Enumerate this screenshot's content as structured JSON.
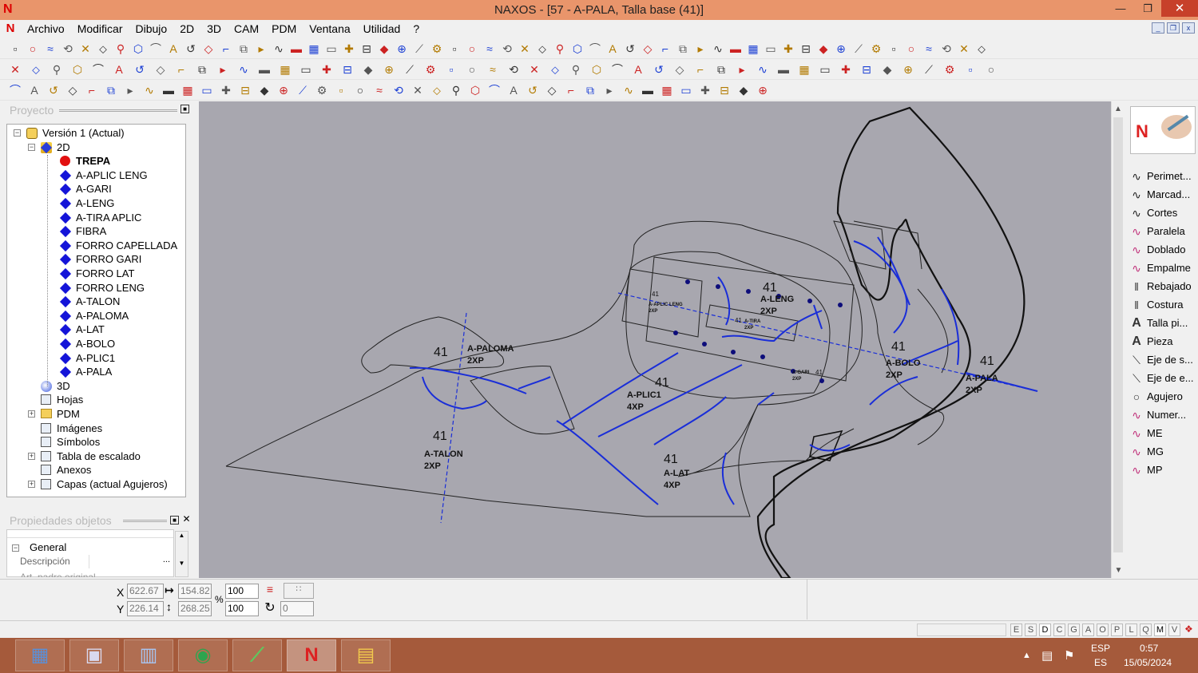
{
  "window": {
    "title": "NAXOS - [57 - A-PALA, Talla base (41)]"
  },
  "menu": [
    "Archivo",
    "Modificar",
    "Dibujo",
    "2D",
    "3D",
    "CAM",
    "PDM",
    "Ventana",
    "Utilidad",
    "?"
  ],
  "project_panel": {
    "title": "Proyecto",
    "tree": [
      {
        "label": "Versión 1 (Actual)",
        "level": 0,
        "expander": "−",
        "icon": "version-icon"
      },
      {
        "label": "2D",
        "level": 1,
        "expander": "−",
        "icon": "2d-icon"
      },
      {
        "label": "TREPA",
        "level": 2,
        "icon": "red-dot-icon",
        "bold": true
      },
      {
        "label": "A-APLIC LENG",
        "level": 2,
        "icon": "piece-diamond-icon"
      },
      {
        "label": "A-GARI",
        "level": 2,
        "icon": "piece-diamond-icon"
      },
      {
        "label": "A-LENG",
        "level": 2,
        "icon": "piece-diamond-icon"
      },
      {
        "label": "A-TIRA APLIC",
        "level": 2,
        "icon": "piece-diamond-icon"
      },
      {
        "label": "FIBRA",
        "level": 2,
        "icon": "piece-diamond-icon"
      },
      {
        "label": "FORRO CAPELLADA",
        "level": 2,
        "icon": "piece-diamond-icon"
      },
      {
        "label": "FORRO GARI",
        "level": 2,
        "icon": "piece-diamond-icon"
      },
      {
        "label": "FORRO LAT",
        "level": 2,
        "icon": "piece-diamond-icon"
      },
      {
        "label": "FORRO LENG",
        "level": 2,
        "icon": "piece-diamond-icon"
      },
      {
        "label": "A-TALON",
        "level": 2,
        "icon": "piece-diamond-icon"
      },
      {
        "label": "A-PALOMA",
        "level": 2,
        "icon": "piece-diamond-icon"
      },
      {
        "label": "A-LAT",
        "level": 2,
        "icon": "piece-diamond-icon"
      },
      {
        "label": "A-BOLO",
        "level": 2,
        "icon": "piece-diamond-icon"
      },
      {
        "label": "A-PLIC1",
        "level": 2,
        "icon": "piece-diamond-icon"
      },
      {
        "label": "A-PALA",
        "level": 2,
        "icon": "piece-diamond-icon"
      },
      {
        "label": "3D",
        "level": 1,
        "icon": "3d-icon"
      },
      {
        "label": "Hojas",
        "level": 1,
        "icon": "sheets-icon"
      },
      {
        "label": "PDM",
        "level": 1,
        "expander": "+",
        "icon": "folder-icon"
      },
      {
        "label": "Imágenes",
        "level": 1,
        "icon": "images-icon"
      },
      {
        "label": "Símbolos",
        "level": 1,
        "icon": "symbols-icon"
      },
      {
        "label": "Tabla de escalado",
        "level": 1,
        "expander": "+",
        "icon": "table-icon"
      },
      {
        "label": "Anexos",
        "level": 1,
        "icon": "attachment-icon"
      },
      {
        "label": "Capas (actual Agujeros)",
        "level": 1,
        "expander": "+",
        "icon": "layers-icon"
      }
    ]
  },
  "properties_panel": {
    "title": "Propiedades objetos",
    "group": "General",
    "rows": [
      {
        "label": "Descripción",
        "value": "",
        "button": "..."
      },
      {
        "label": "Art. padre original",
        "value": ""
      }
    ]
  },
  "pieces": [
    {
      "size": "41",
      "name": "A-PALOMA",
      "qty": "2XP"
    },
    {
      "size": "41",
      "name": "A-TALON",
      "qty": "2XP"
    },
    {
      "size": "41",
      "name": "A-APLIC LENG",
      "qty": "2XP"
    },
    {
      "size": "41",
      "name": "A-LENG",
      "qty": "2XP"
    },
    {
      "size": "41",
      "name": "A-TIRA",
      "qty": "2XP"
    },
    {
      "size": "41",
      "name": "A-PLIC1",
      "qty": "4XP"
    },
    {
      "size": "41",
      "name": "A-GARI",
      "qty": "2XP"
    },
    {
      "size": "41",
      "name": "A-LAT",
      "qty": "4XP"
    },
    {
      "size": "41",
      "name": "A-BOLO",
      "qty": "2XP"
    },
    {
      "size": "41",
      "name": "A-PALA",
      "qty": "2XP"
    }
  ],
  "right_panel": {
    "items": [
      {
        "label": "Perimet...",
        "icon": "perimeter-icon"
      },
      {
        "label": "Marcad...",
        "icon": "marker-icon"
      },
      {
        "label": "Cortes",
        "icon": "cuts-icon"
      },
      {
        "label": "Paralela",
        "icon": "parallel-icon"
      },
      {
        "label": "Doblado",
        "icon": "fold-icon"
      },
      {
        "label": "Empalme",
        "icon": "joint-icon"
      },
      {
        "label": "Rebajado",
        "icon": "skive-icon"
      },
      {
        "label": "Costura",
        "icon": "seam-icon"
      },
      {
        "label": "Talla pi...",
        "icon": "size-text-icon"
      },
      {
        "label": "Pieza",
        "icon": "piece-text-icon"
      },
      {
        "label": "Eje de s...",
        "icon": "axis-icon"
      },
      {
        "label": "Eje de e...",
        "icon": "axis-icon"
      },
      {
        "label": "Agujero",
        "icon": "hole-icon"
      },
      {
        "label": "Numer...",
        "icon": "numbering-icon"
      },
      {
        "label": "ME",
        "icon": "me-icon"
      },
      {
        "label": "MG",
        "icon": "mg-icon"
      },
      {
        "label": "MP",
        "icon": "mp-icon"
      }
    ]
  },
  "coords": {
    "x_label": "X",
    "y_label": "Y",
    "x": "622.67",
    "y": "226.14",
    "width": "154.82",
    "height": "268.25",
    "scale_x": "100",
    "scale_y": "100",
    "percent": "%",
    "rotation": "0"
  },
  "status_flags": [
    "E",
    "S",
    "D",
    "C",
    "G",
    "A",
    "O",
    "P",
    "L",
    "Q",
    "M",
    "V"
  ],
  "taskbar": {
    "apps": [
      "calculator-icon",
      "explorer-icon",
      "installer-icon",
      "chrome-icon",
      "cad-icon",
      "naxos-icon",
      "folder-icon"
    ],
    "lang_top": "ESP",
    "lang_bottom": "ES",
    "time": "0:57",
    "date": "15/05/2024"
  },
  "colors": {
    "canvas": "#a8a7af",
    "title_bar": "#e9956b",
    "taskbar": "#a55a3b",
    "curve_blue": "#1a2ed8"
  }
}
